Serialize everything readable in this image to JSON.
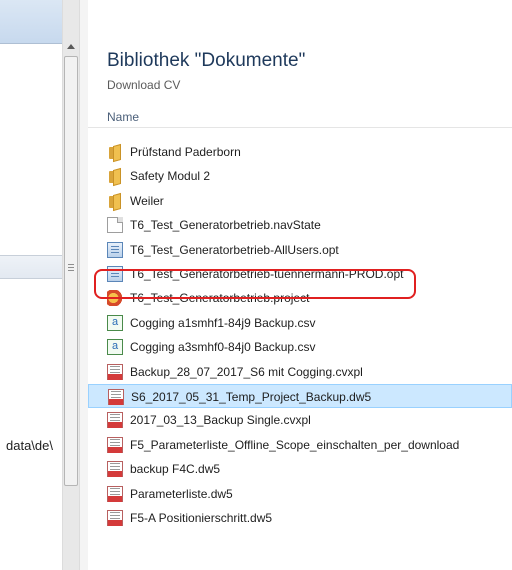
{
  "navigation": {
    "path_fragment": "data\\de\\"
  },
  "library": {
    "title": "Bibliothek \"Dokumente\"",
    "subtitle": "Download CV"
  },
  "columns": {
    "name_header": "Name"
  },
  "files": [
    {
      "name": "Prüfstand Paderborn",
      "type": "folder-icon"
    },
    {
      "name": "Safety Modul 2",
      "type": "folder-icon"
    },
    {
      "name": "Weiler",
      "type": "folder-icon"
    },
    {
      "name": "T6_Test_Generatorbetrieb.navState",
      "type": "document-icon"
    },
    {
      "name": "T6_Test_Generatorbetrieb-AllUsers.opt",
      "type": "options-file-icon"
    },
    {
      "name": "T6_Test_Generatorbetrieb-tuennermann-PROD.opt",
      "type": "options-file-icon"
    },
    {
      "name": "T6_Test_Generatorbetrieb.project",
      "type": "project-file-icon"
    },
    {
      "name": "Cogging a1smhf1-84j9 Backup.csv",
      "type": "csv-file-icon"
    },
    {
      "name": "Cogging a3smhf0-84j0 Backup.csv",
      "type": "csv-file-icon"
    },
    {
      "name": "Backup_28_07_2017_S6 mit Cogging.cvxpl",
      "type": "keb-file-icon"
    },
    {
      "name": "S6_2017_05_31_Temp_Project_Backup.dw5",
      "type": "keb-file-icon",
      "selected": true
    },
    {
      "name": "2017_03_13_Backup Single.cvxpl",
      "type": "keb-file-icon"
    },
    {
      "name": "F5_Parameterliste_Offline_Scope_einschalten_per_download",
      "type": "keb-file-icon"
    },
    {
      "name": "backup F4C.dw5",
      "type": "keb-file-icon"
    },
    {
      "name": "Parameterliste.dw5",
      "type": "keb-file-icon"
    },
    {
      "name": "F5-A Positionierschritt.dw5",
      "type": "keb-file-icon"
    }
  ],
  "colors": {
    "title": "#1e395b",
    "selection": "#cce8ff",
    "highlight_ring": "#e02020"
  }
}
